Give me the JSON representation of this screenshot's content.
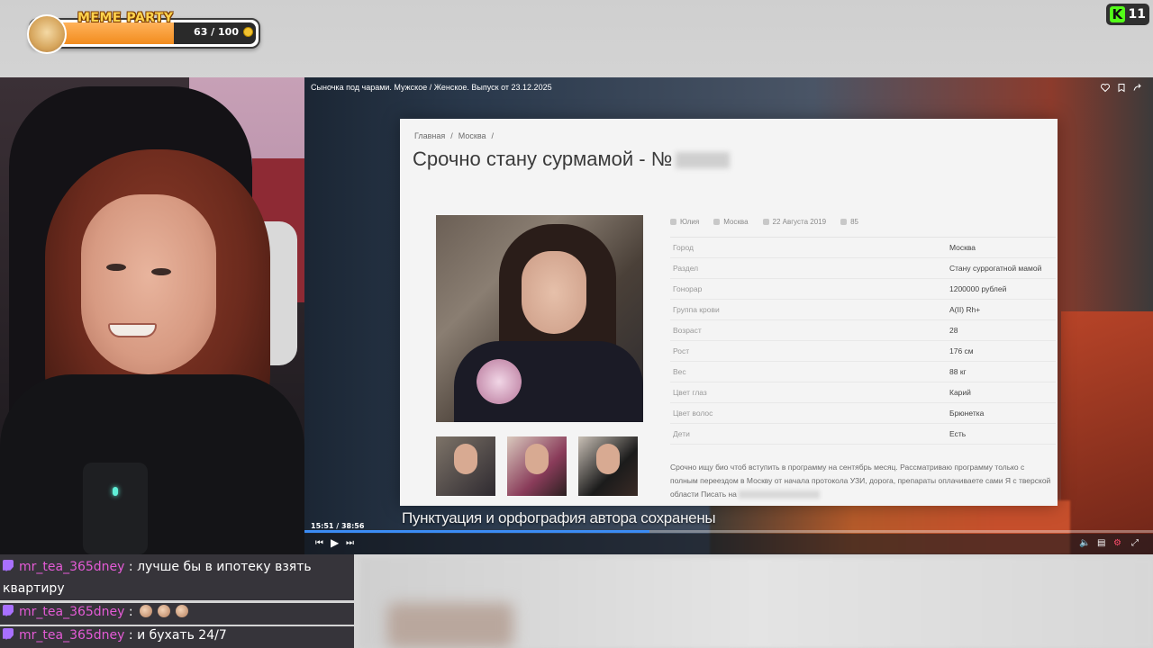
{
  "widget": {
    "title": "MEME PARTY",
    "count": "63 / 100",
    "progress": 0.63
  },
  "kick": {
    "logo": "K",
    "viewers": "11"
  },
  "player": {
    "title": "Сыночка под чарами. Мужское / Женское. Выпуск от 23.12.2025",
    "timecode": "15:51 / 38:56",
    "progress": 0.407,
    "caption": "Пунктуация и орфография автора сохранены",
    "actions": [
      "heart-icon",
      "bookmark-icon",
      "share-icon"
    ],
    "progress_color": "#3b8cf5"
  },
  "listing": {
    "breadcrumb": [
      "Главная",
      "/",
      "Москва",
      "/"
    ],
    "title": "Срочно стану сурмамой - №",
    "meta": {
      "author": "Юлия",
      "city": "Москва",
      "date": "22 Августа 2019",
      "views": "85"
    },
    "specs": [
      {
        "label": "Город",
        "value": "Москва"
      },
      {
        "label": "Раздел",
        "value": "Стану суррогатной мамой"
      },
      {
        "label": "Гонорар",
        "value": "1200000 рублей"
      },
      {
        "label": "Группа крови",
        "value": "A(II) Rh+"
      },
      {
        "label": "Возраст",
        "value": "28"
      },
      {
        "label": "Рост",
        "value": "176 см"
      },
      {
        "label": "Вес",
        "value": "88 кг"
      },
      {
        "label": "Цвет глаз",
        "value": "Карий"
      },
      {
        "label": "Цвет волос",
        "value": "Брюнетка"
      },
      {
        "label": "Дети",
        "value": "Есть"
      }
    ],
    "description": "Срочно ищу био чтоб вступить в программу на сентябрь месяц. Рассматриваю программу только с полным переездом в Москву от начала протокола УЗИ, дорога, препараты оплачиваете сами Я с тверской области Писать на"
  },
  "chat": [
    {
      "user": "mr_tea_365dney",
      "text": "лучше бы в ипотеку взять квартиру"
    },
    {
      "user": "mr_tea_365dney",
      "text": ""
    },
    {
      "user": "mr_tea_365dney",
      "text": "и бухать 24/7"
    }
  ],
  "chat_separator": ":"
}
